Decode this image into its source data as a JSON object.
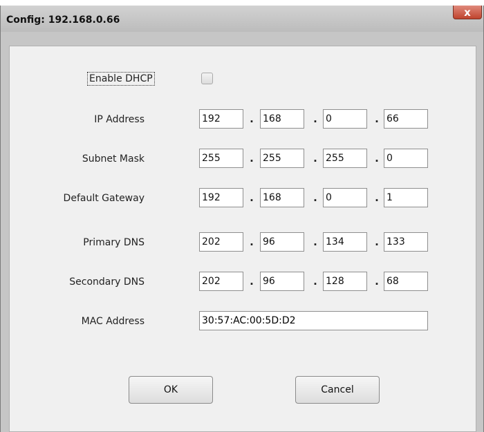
{
  "window": {
    "title": "Config: 192.168.0.66",
    "close_label": "x"
  },
  "dhcp": {
    "label": "Enable DHCP",
    "checked": false
  },
  "fields": [
    {
      "label": "IP Address",
      "octets": [
        "192",
        "168",
        "0",
        "66"
      ]
    },
    {
      "label": "Subnet Mask",
      "octets": [
        "255",
        "255",
        "255",
        "0"
      ]
    },
    {
      "label": "Default Gateway",
      "octets": [
        "192",
        "168",
        "0",
        "1"
      ]
    },
    {
      "label": "Primary DNS",
      "octets": [
        "202",
        "96",
        "134",
        "133"
      ]
    },
    {
      "label": "Secondary DNS",
      "octets": [
        "202",
        "96",
        "128",
        "68"
      ]
    }
  ],
  "separator": ".",
  "mac": {
    "label": "MAC Address",
    "value": "30:57:AC:00:5D:D2"
  },
  "buttons": {
    "ok": "OK",
    "cancel": "Cancel"
  }
}
